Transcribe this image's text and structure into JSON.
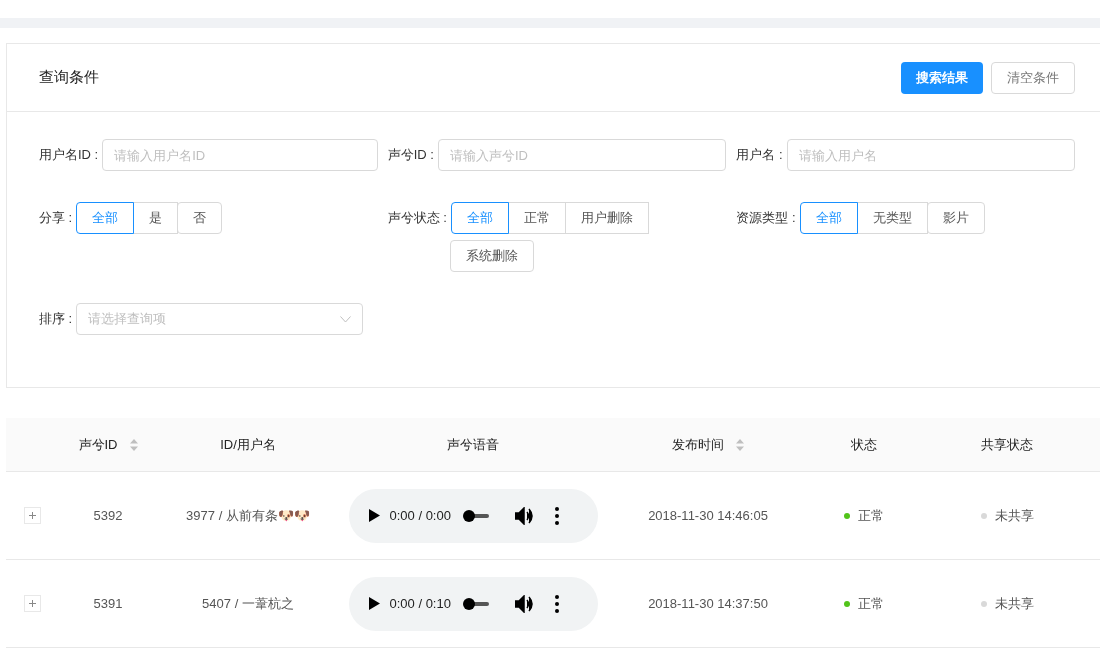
{
  "query_panel": {
    "title": "查询条件",
    "buttons": [
      {
        "label": "搜索结果",
        "kind": "primary"
      },
      {
        "label": "清空条件",
        "kind": "default"
      }
    ],
    "inputs": [
      {
        "label": "用户名ID :",
        "placeholder": "请输入用户名ID"
      },
      {
        "label": "声兮ID :",
        "placeholder": "请输入声兮ID"
      },
      {
        "label": "用户名 :",
        "placeholder": "请输入用户名"
      }
    ],
    "segments": [
      {
        "label": "分享 :",
        "options": [
          {
            "label": "全部",
            "selected": true
          },
          {
            "label": "是",
            "selected": false
          },
          {
            "label": "否",
            "selected": false
          }
        ]
      },
      {
        "label": "声兮状态 :",
        "options": [
          {
            "label": "全部",
            "selected": true
          },
          {
            "label": "正常",
            "selected": false
          },
          {
            "label": "用户删除",
            "selected": false
          },
          {
            "label": "系统删除",
            "selected": false
          }
        ]
      },
      {
        "label": "资源类型 :",
        "options": [
          {
            "label": "全部",
            "selected": true
          },
          {
            "label": "无类型",
            "selected": false
          },
          {
            "label": "影片",
            "selected": false
          }
        ]
      }
    ],
    "sort": {
      "label": "排序 :",
      "placeholder": "请选择查询项"
    }
  },
  "table": {
    "columns": [
      {
        "label": "声兮ID",
        "sortable": true
      },
      {
        "label": "ID/用户名",
        "sortable": false
      },
      {
        "label": "声兮语音",
        "sortable": false
      },
      {
        "label": "发布时间",
        "sortable": true
      },
      {
        "label": "状态",
        "sortable": false
      },
      {
        "label": "共享状态",
        "sortable": false
      }
    ],
    "rows": [
      {
        "id": "5392",
        "user": "3977 / 从前有条🐶🐶",
        "audio": {
          "time": "0:00 / 0:00",
          "level": 0
        },
        "published": "2018-11-30 14:46:05",
        "status": {
          "text": "正常",
          "color": "#52c41a"
        },
        "share": {
          "text": "未共享",
          "color": "#d9d9d9"
        }
      },
      {
        "id": "5391",
        "user": "5407 / 一葦杭之",
        "audio": {
          "time": "0:00 / 0:10",
          "level": 0
        },
        "published": "2018-11-30 14:37:50",
        "status": {
          "text": "正常",
          "color": "#52c41a"
        },
        "share": {
          "text": "未共享",
          "color": "#d9d9d9"
        }
      }
    ]
  }
}
